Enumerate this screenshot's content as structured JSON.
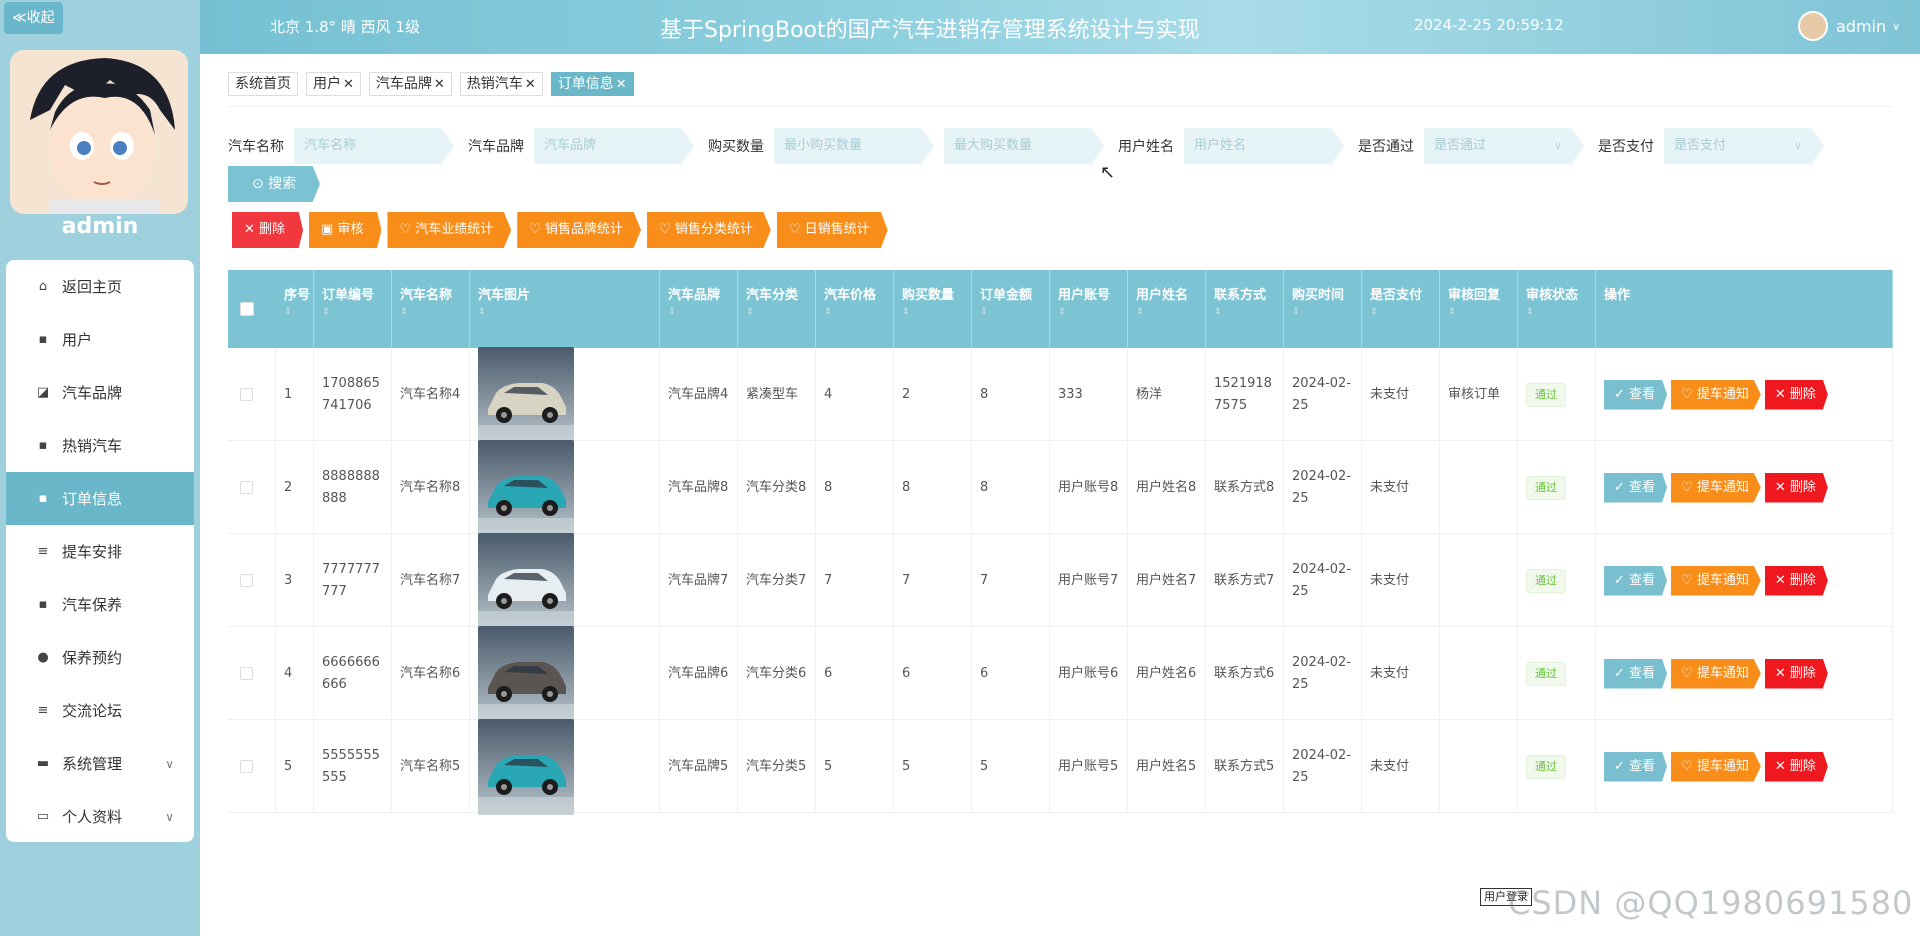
{
  "sidebar": {
    "collapse_label": "≪收起",
    "admin_name": "admin",
    "menu": [
      {
        "label": "返回主页",
        "icon": "home-icon"
      },
      {
        "label": "用户",
        "icon": "grid-icon"
      },
      {
        "label": "汽车品牌",
        "icon": "chart-icon"
      },
      {
        "label": "热销汽车",
        "icon": "grid-icon"
      },
      {
        "label": "订单信息",
        "icon": "grid-icon",
        "active": true
      },
      {
        "label": "提车安排",
        "icon": "list-icon"
      },
      {
        "label": "汽车保养",
        "icon": "grid-icon"
      },
      {
        "label": "保养预约",
        "icon": "person-icon"
      },
      {
        "label": "交流论坛",
        "icon": "list-icon"
      },
      {
        "label": "系统管理",
        "icon": "monitor-icon",
        "expandable": true
      },
      {
        "label": "个人资料",
        "icon": "card-icon",
        "expandable": true
      }
    ]
  },
  "header": {
    "weather": "北京  1.8°  晴  西风  1级",
    "title": "基于SpringBoot的国产汽车进销存管理系统设计与实现",
    "datetime": "2024-2-25 20:59:12",
    "user": "admin"
  },
  "tabs": [
    {
      "label": "系统首页",
      "closable": false
    },
    {
      "label": "用户",
      "closable": true
    },
    {
      "label": "汽车品牌",
      "closable": true
    },
    {
      "label": "热销汽车",
      "closable": true
    },
    {
      "label": "订单信息",
      "closable": true,
      "active": true
    }
  ],
  "search": {
    "car_name_label": "汽车名称",
    "car_name_placeholder": "汽车名称",
    "brand_label": "汽车品牌",
    "brand_placeholder": "汽车品牌",
    "qty_label": "购买数量",
    "qty_min_placeholder": "最小购买数量",
    "qty_max_placeholder": "最大购买数量",
    "username_label": "用户姓名",
    "username_placeholder": "用户姓名",
    "passed_label": "是否通过",
    "passed_placeholder": "是否通过",
    "paid_label": "是否支付",
    "paid_placeholder": "是否支付",
    "search_button": "⊙ 搜索"
  },
  "actions": {
    "delete": "✕ 删除",
    "audit": "▣ 审核",
    "stat_performance": "♡ 汽车业绩统计",
    "stat_brand": "♡ 销售品牌统计",
    "stat_category": "♡ 销售分类统计",
    "stat_daily": "♡ 日销售统计"
  },
  "table": {
    "headers": [
      "序号",
      "订单编号",
      "汽车名称",
      "汽车图片",
      "汽车品牌",
      "汽车分类",
      "汽车价格",
      "购买数量",
      "订单金额",
      "用户账号",
      "用户姓名",
      "联系方式",
      "购买时间",
      "是否支付",
      "审核回复",
      "审核状态",
      "操作"
    ],
    "rows": [
      {
        "idx": "1",
        "order_no": "1708865741706",
        "car_name": "汽车名称4",
        "img_color": "#d8d4c4",
        "brand": "汽车品牌4",
        "category": "紧凑型车",
        "price": "4",
        "qty": "2",
        "amount": "8",
        "account": "333",
        "username": "杨洋",
        "phone": "15219187575",
        "time": "2024-02-25",
        "paid": "未支付",
        "reply": "审核订单",
        "status": "通过"
      },
      {
        "idx": "2",
        "order_no": "8888888888",
        "car_name": "汽车名称8",
        "img_color": "#2aa7b5",
        "brand": "汽车品牌8",
        "category": "汽车分类8",
        "price": "8",
        "qty": "8",
        "amount": "8",
        "account": "用户账号8",
        "username": "用户姓名8",
        "phone": "联系方式8",
        "time": "2024-02-25",
        "paid": "未支付",
        "reply": "",
        "status": "通过"
      },
      {
        "idx": "3",
        "order_no": "7777777777",
        "car_name": "汽车名称7",
        "img_color": "#e6eef2",
        "brand": "汽车品牌7",
        "category": "汽车分类7",
        "price": "7",
        "qty": "7",
        "amount": "7",
        "account": "用户账号7",
        "username": "用户姓名7",
        "phone": "联系方式7",
        "time": "2024-02-25",
        "paid": "未支付",
        "reply": "",
        "status": "通过"
      },
      {
        "idx": "4",
        "order_no": "6666666666",
        "car_name": "汽车名称6",
        "img_color": "#5a5550",
        "brand": "汽车品牌6",
        "category": "汽车分类6",
        "price": "6",
        "qty": "6",
        "amount": "6",
        "account": "用户账号6",
        "username": "用户姓名6",
        "phone": "联系方式6",
        "time": "2024-02-25",
        "paid": "未支付",
        "reply": "",
        "status": "通过"
      },
      {
        "idx": "5",
        "order_no": "5555555555",
        "car_name": "汽车名称5",
        "img_color": "#2aa7b5",
        "brand": "汽车品牌5",
        "category": "汽车分类5",
        "price": "5",
        "qty": "5",
        "amount": "5",
        "account": "用户账号5",
        "username": "用户姓名5",
        "phone": "联系方式5",
        "time": "2024-02-25",
        "paid": "未支付",
        "reply": "",
        "status": "通过"
      }
    ],
    "op_view": "✓ 查看",
    "op_notify": "♡ 提车通知",
    "op_delete": "✕ 删除"
  },
  "tooltip": "用户登录",
  "watermark": "CSDN @QQ1980691580"
}
